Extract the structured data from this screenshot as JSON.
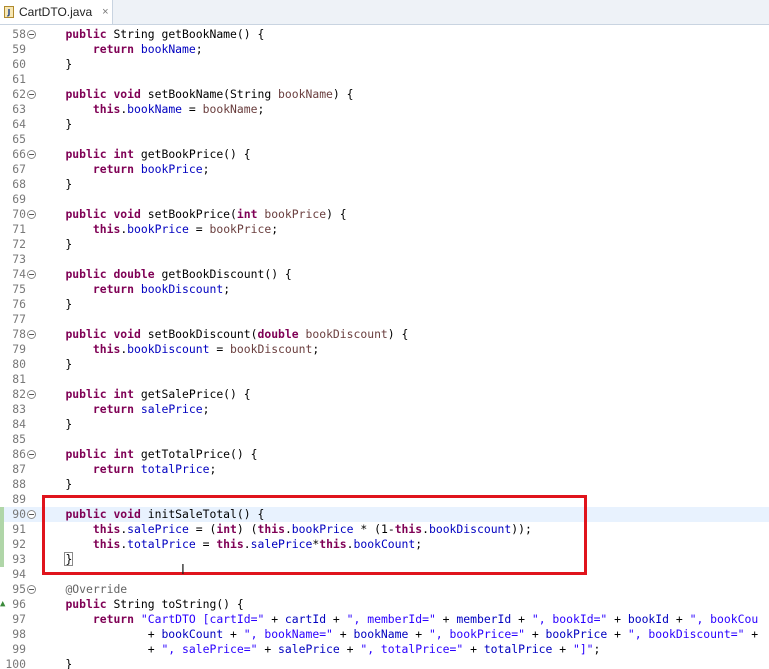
{
  "tab": {
    "title": "CartDTO.java",
    "icon_letter": "J",
    "close_glyph": "×"
  },
  "override_marker": "▲",
  "cursor_glyph": "I",
  "lines": [
    {
      "num": "58",
      "fold": true,
      "code": "    <span class=\"kw\">public</span> String getBookName() {"
    },
    {
      "num": "59",
      "fold": false,
      "code": "        <span class=\"kw\">return</span> <span class=\"fld\">bookName</span>;"
    },
    {
      "num": "60",
      "fold": false,
      "code": "    }"
    },
    {
      "num": "61",
      "fold": false,
      "code": ""
    },
    {
      "num": "62",
      "fold": true,
      "code": "    <span class=\"kw\">public</span> <span class=\"kw\">void</span> setBookName(String <span class=\"param\">bookName</span>) {"
    },
    {
      "num": "63",
      "fold": false,
      "code": "        <span class=\"kw\">this</span>.<span class=\"fld\">bookName</span> = <span class=\"param\">bookName</span>;"
    },
    {
      "num": "64",
      "fold": false,
      "code": "    }"
    },
    {
      "num": "65",
      "fold": false,
      "code": ""
    },
    {
      "num": "66",
      "fold": true,
      "code": "    <span class=\"kw\">public</span> <span class=\"kw\">int</span> getBookPrice() {"
    },
    {
      "num": "67",
      "fold": false,
      "code": "        <span class=\"kw\">return</span> <span class=\"fld\">bookPrice</span>;"
    },
    {
      "num": "68",
      "fold": false,
      "code": "    }"
    },
    {
      "num": "69",
      "fold": false,
      "code": ""
    },
    {
      "num": "70",
      "fold": true,
      "code": "    <span class=\"kw\">public</span> <span class=\"kw\">void</span> setBookPrice(<span class=\"kw\">int</span> <span class=\"param\">bookPrice</span>) {"
    },
    {
      "num": "71",
      "fold": false,
      "code": "        <span class=\"kw\">this</span>.<span class=\"fld\">bookPrice</span> = <span class=\"param\">bookPrice</span>;"
    },
    {
      "num": "72",
      "fold": false,
      "code": "    }"
    },
    {
      "num": "73",
      "fold": false,
      "code": ""
    },
    {
      "num": "74",
      "fold": true,
      "code": "    <span class=\"kw\">public</span> <span class=\"kw\">double</span> getBookDiscount() {"
    },
    {
      "num": "75",
      "fold": false,
      "code": "        <span class=\"kw\">return</span> <span class=\"fld\">bookDiscount</span>;"
    },
    {
      "num": "76",
      "fold": false,
      "code": "    }"
    },
    {
      "num": "77",
      "fold": false,
      "code": ""
    },
    {
      "num": "78",
      "fold": true,
      "code": "    <span class=\"kw\">public</span> <span class=\"kw\">void</span> setBookDiscount(<span class=\"kw\">double</span> <span class=\"param\">bookDiscount</span>) {"
    },
    {
      "num": "79",
      "fold": false,
      "code": "        <span class=\"kw\">this</span>.<span class=\"fld\">bookDiscount</span> = <span class=\"param\">bookDiscount</span>;"
    },
    {
      "num": "80",
      "fold": false,
      "code": "    }"
    },
    {
      "num": "81",
      "fold": false,
      "code": ""
    },
    {
      "num": "82",
      "fold": true,
      "code": "    <span class=\"kw\">public</span> <span class=\"kw\">int</span> getSalePrice() {"
    },
    {
      "num": "83",
      "fold": false,
      "code": "        <span class=\"kw\">return</span> <span class=\"fld\">salePrice</span>;"
    },
    {
      "num": "84",
      "fold": false,
      "code": "    }"
    },
    {
      "num": "85",
      "fold": false,
      "code": ""
    },
    {
      "num": "86",
      "fold": true,
      "code": "    <span class=\"kw\">public</span> <span class=\"kw\">int</span> getTotalPrice() {"
    },
    {
      "num": "87",
      "fold": false,
      "code": "        <span class=\"kw\">return</span> <span class=\"fld\">totalPrice</span>;"
    },
    {
      "num": "88",
      "fold": false,
      "code": "    }"
    },
    {
      "num": "89",
      "fold": false,
      "code": ""
    },
    {
      "num": "90",
      "fold": true,
      "code": "    <span class=\"kw\">public</span> <span class=\"kw\">void</span> initSaleTotal() {",
      "highlight": true,
      "changed": true
    },
    {
      "num": "91",
      "fold": false,
      "code": "        <span class=\"kw\">this</span>.<span class=\"fld\">salePrice</span> = (<span class=\"kw\">int</span>) (<span class=\"kw\">this</span>.<span class=\"fld\">bookPrice</span> * (1-<span class=\"kw\">this</span>.<span class=\"fld\">bookDiscount</span>));",
      "changed": true
    },
    {
      "num": "92",
      "fold": false,
      "code": "        <span class=\"kw\">this</span>.<span class=\"fld\">totalPrice</span> = <span class=\"kw\">this</span>.<span class=\"fld\">salePrice</span>*<span class=\"kw\">this</span>.<span class=\"fld\">bookCount</span>;",
      "changed": true
    },
    {
      "num": "93",
      "fold": false,
      "code": "    <span class=\"bracket-mark\">}</span>",
      "changed": true
    },
    {
      "num": "94",
      "fold": false,
      "code": ""
    },
    {
      "num": "95",
      "fold": true,
      "code": "    <span class=\"ann\">@Override</span>"
    },
    {
      "num": "96",
      "fold": false,
      "code": "    <span class=\"kw\">public</span> String toString() {",
      "override": true
    },
    {
      "num": "97",
      "fold": false,
      "code": "        <span class=\"kw\">return</span> <span class=\"str\">\"CartDTO [cartId=\"</span> + <span class=\"fld\">cartId</span> + <span class=\"str\">\", memberId=\"</span> + <span class=\"fld\">memberId</span> + <span class=\"str\">\", bookId=\"</span> + <span class=\"fld\">bookId</span> + <span class=\"str\">\", bookCou</span>"
    },
    {
      "num": "98",
      "fold": false,
      "code": "                + <span class=\"fld\">bookCount</span> + <span class=\"str\">\", bookName=\"</span> + <span class=\"fld\">bookName</span> + <span class=\"str\">\", bookPrice=\"</span> + <span class=\"fld\">bookPrice</span> + <span class=\"str\">\", bookDiscount=\"</span> +"
    },
    {
      "num": "99",
      "fold": false,
      "code": "                + <span class=\"str\">\", salePrice=\"</span> + <span class=\"fld\">salePrice</span> + <span class=\"str\">\", totalPrice=\"</span> + <span class=\"fld\">totalPrice</span> + <span class=\"str\">\"]\"</span>;"
    },
    {
      "num": "100",
      "fold": false,
      "code": "    }"
    }
  ]
}
